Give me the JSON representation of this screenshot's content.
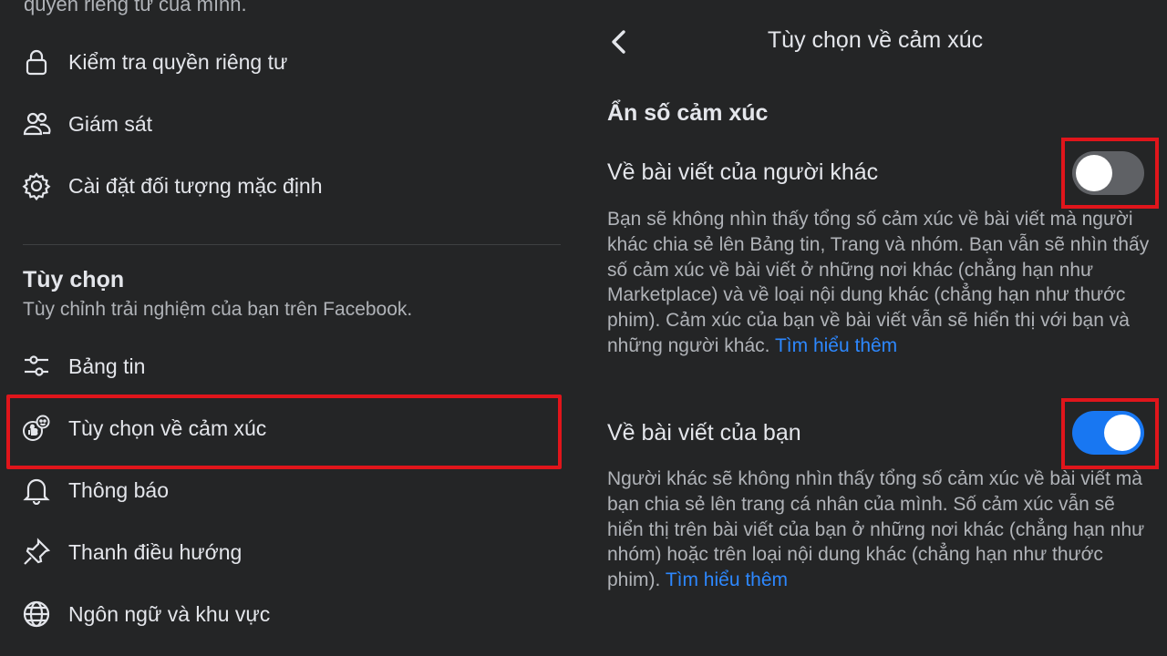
{
  "left_panel": {
    "cut_off_text": "quyền riêng tư của mình.",
    "items_top": [
      {
        "label": "Kiểm tra quyền riêng tư",
        "icon": "lock-icon"
      },
      {
        "label": "Giám sát",
        "icon": "people-icon"
      },
      {
        "label": "Cài đặt đối tượng mặc định",
        "icon": "gear-icon"
      }
    ],
    "section": {
      "title": "Tùy chọn",
      "subtitle": "Tùy chỉnh trải nghiệm của bạn trên Facebook."
    },
    "items_bottom": [
      {
        "label": "Bảng tin",
        "icon": "sliders-icon"
      },
      {
        "label": "Tùy chọn về cảm xúc",
        "icon": "reactions-icon",
        "highlighted": true
      },
      {
        "label": "Thông báo",
        "icon": "bell-icon"
      },
      {
        "label": "Thanh điều hướng",
        "icon": "pin-icon"
      },
      {
        "label": "Ngôn ngữ và khu vực",
        "icon": "globe-icon"
      }
    ]
  },
  "right_panel": {
    "header": {
      "title": "Tùy chọn về cảm xúc",
      "back_icon": "chevron-left-icon"
    },
    "section_title": "Ẩn số cảm xúc",
    "options": [
      {
        "title": "Về bài viết của người khác",
        "toggle_state": "off",
        "description": "Bạn sẽ không nhìn thấy tổng số cảm xúc về bài viết mà người khác chia sẻ lên Bảng tin, Trang và nhóm. Bạn vẫn sẽ nhìn thấy số cảm xúc về bài viết ở những nơi khác (chẳng hạn như Marketplace) và về loại nội dung khác (chẳng hạn như thước phim). Cảm xúc của bạn về bài viết vẫn sẽ hiển thị với bạn và những người khác. ",
        "link": "Tìm hiểu thêm"
      },
      {
        "title": "Về bài viết của bạn",
        "toggle_state": "on",
        "description": "Người khác sẽ không nhìn thấy tổng số cảm xúc về bài viết mà bạn chia sẻ lên trang cá nhân của mình. Số cảm xúc vẫn sẽ hiển thị trên bài viết của bạn ở những nơi khác (chẳng hạn như nhóm) hoặc trên loại nội dung khác (chẳng hạn như thước phim). ",
        "link": "Tìm hiểu thêm"
      }
    ]
  },
  "colors": {
    "background": "#242526",
    "text_primary": "#e4e6eb",
    "text_secondary": "#b0b3b8",
    "link": "#2d88ff",
    "toggle_on": "#1877f2",
    "toggle_off": "#5f6165",
    "highlight_border": "#e0151b"
  }
}
